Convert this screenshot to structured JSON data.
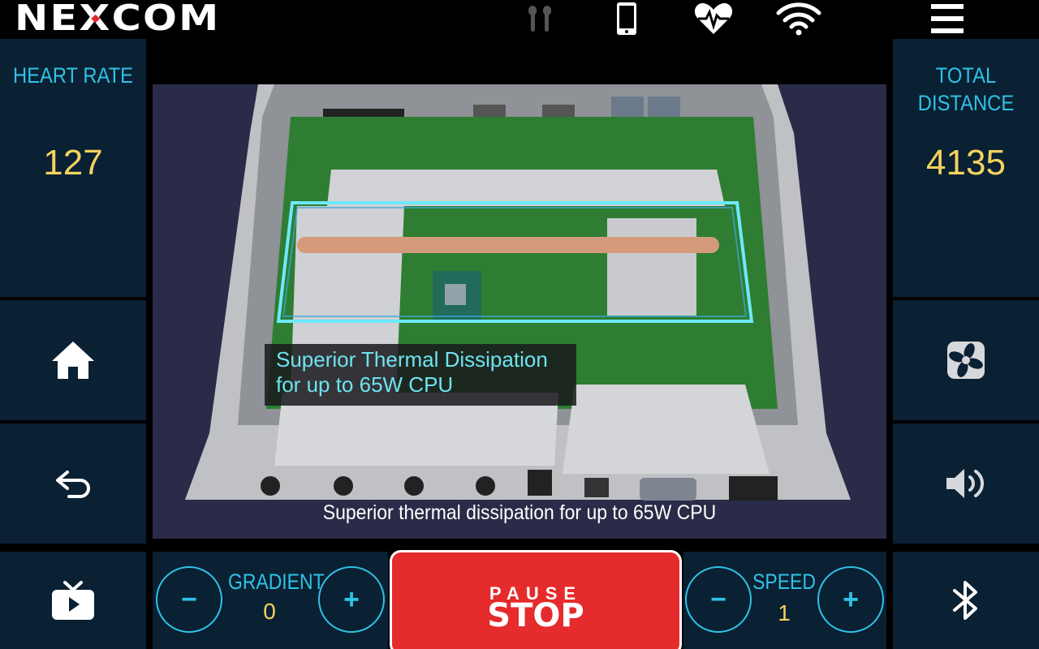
{
  "brand": {
    "logo": "NEXCOM"
  },
  "top_icons": [
    "earbuds-icon",
    "phone-icon",
    "heart-pulse-icon",
    "wifi-icon",
    "menu-icon"
  ],
  "left_panel": {
    "heart_rate_label": "HEART RATE",
    "heart_rate_value": "127"
  },
  "right_panel": {
    "total_distance_label_line1": "TOTAL",
    "total_distance_label_line2": "DISTANCE",
    "total_distance_value": "4135"
  },
  "video": {
    "overlay_line1": "Superior Thermal Dissipation",
    "overlay_line2": "for up to 65W CPU",
    "caption": "Superior thermal dissipation for up to 65W CPU"
  },
  "side_buttons": {
    "left": [
      "home-icon",
      "back-icon",
      "tv-icon"
    ],
    "right": [
      "fan-icon",
      "volume-icon",
      "bluetooth-icon"
    ]
  },
  "controls": {
    "gradient_label": "GRADIENT",
    "gradient_value": "0",
    "speed_label": "SPEED",
    "speed_value": "1",
    "minus": "−",
    "plus": "+",
    "pause_label": "PAUSE",
    "stop_label": "STOP"
  },
  "colors": {
    "accent": "#2ec3e6",
    "value": "#f4d35e",
    "panel": "#0a2033",
    "stop": "#e52b2b"
  }
}
